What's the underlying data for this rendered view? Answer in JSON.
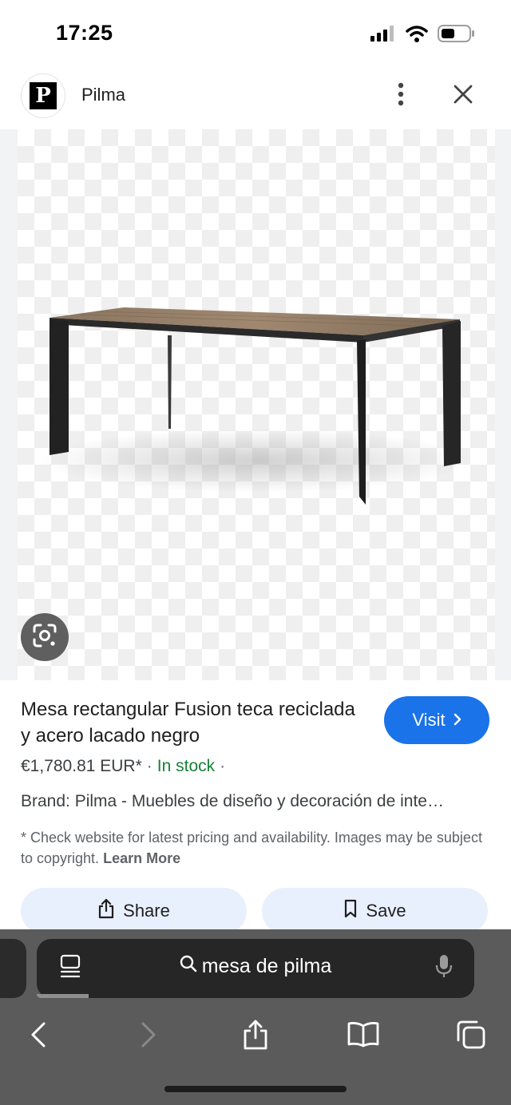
{
  "status_bar": {
    "time": "17:25",
    "icons": [
      "cellular-signal-icon",
      "wifi-icon",
      "battery-icon"
    ]
  },
  "header": {
    "site_logo_letter": "P",
    "site_name": "Pilma",
    "menu_icon": "more-vertical-icon",
    "close_icon": "close-icon"
  },
  "product": {
    "title": "Mesa rectangular Fusion teca reciclada y acero lacado negro",
    "visit_label": "Visit",
    "price": "€1,780.81 EUR*",
    "separator": "·",
    "stock": "In stock",
    "brand": "Brand: Pilma - Muebles de diseño y decoración de inte…",
    "disclaimer": "* Check website for latest pricing and availability. Images may be subject to copyright.",
    "learn_more": "Learn More",
    "share_label": "Share",
    "save_label": "Save"
  },
  "browser": {
    "address_text": "mesa de pilma",
    "toolbar_icons": [
      "back-icon",
      "forward-icon",
      "share-icon",
      "bookmarks-icon",
      "tabs-icon"
    ]
  },
  "colors": {
    "accent": "#1a73e8",
    "in_stock": "#188038",
    "chip_bg": "#e8f0fe",
    "browser_chrome": "#5b5b5b"
  }
}
